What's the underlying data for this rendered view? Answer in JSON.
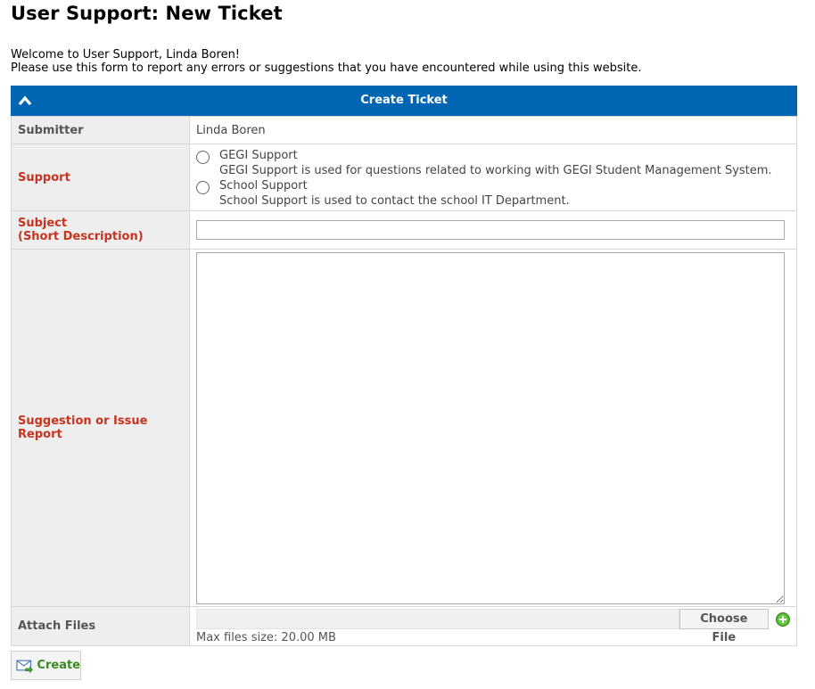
{
  "page": {
    "title": "User Support: New Ticket",
    "welcome": "Welcome to User Support, Linda Boren!",
    "instructions": "Please use this form to report any errors or suggestions that you have encountered while using this website."
  },
  "panel": {
    "header": "Create Ticket",
    "header_color": "#0066b3"
  },
  "form": {
    "submitter_label": "Submitter",
    "submitter_value": "Linda Boren",
    "support_label": "Support",
    "support_options": [
      {
        "label": "GEGI Support",
        "description": "GEGI Support is used for questions related to working with GEGI Student Management System.",
        "selected": false
      },
      {
        "label": "School Support",
        "description": "School Support is used to contact the school IT Department.",
        "selected": false
      }
    ],
    "subject_label_line1": "Subject",
    "subject_label_line2": "(Short Description)",
    "subject_value": "",
    "issue_label": "Suggestion or Issue Report",
    "issue_value": "",
    "attach_label": "Attach Files",
    "choose_file_label": "Choose File",
    "max_size_note": "Max files size: 20.00 MB",
    "required_label_color": "#c8331f"
  },
  "actions": {
    "create_label": "Create"
  },
  "icons": {
    "collapse": "chevron-up-icon",
    "add_file": "add-circle-icon",
    "create": "mail-send-icon"
  }
}
